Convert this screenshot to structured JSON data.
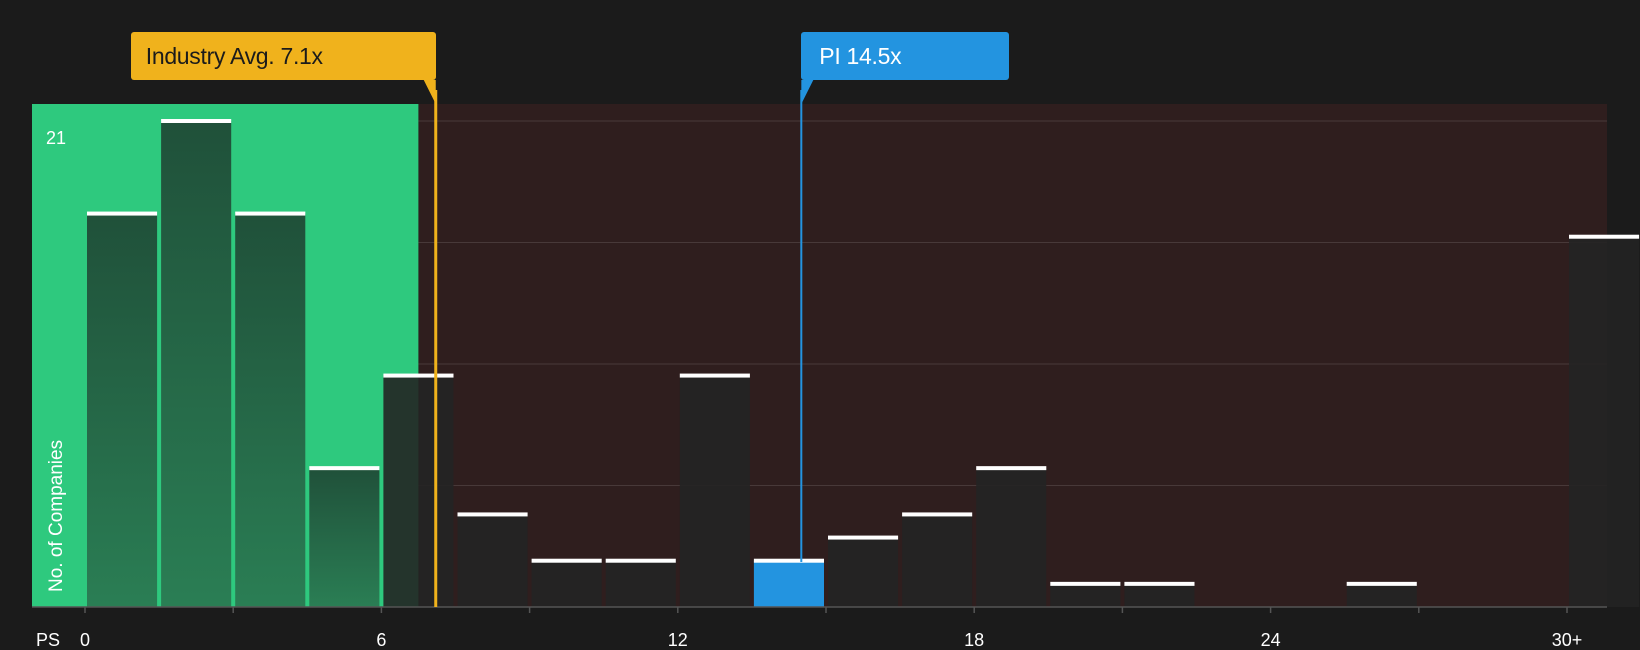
{
  "chart_data": {
    "type": "bar",
    "xlabel": "PS",
    "ylabel": "No. of Companies",
    "x_ticks": [
      "0",
      "6",
      "12",
      "18",
      "24",
      "30+"
    ],
    "y_max_label": "21",
    "ylim": [
      0,
      21
    ],
    "bins": [
      {
        "start": 0,
        "end": 1.5,
        "value": 17
      },
      {
        "start": 1.5,
        "end": 3,
        "value": 21
      },
      {
        "start": 3,
        "end": 4.5,
        "value": 17
      },
      {
        "start": 4.5,
        "end": 6,
        "value": 6
      },
      {
        "start": 6,
        "end": 7.5,
        "value": 10
      },
      {
        "start": 7.5,
        "end": 9,
        "value": 4
      },
      {
        "start": 9,
        "end": 10.5,
        "value": 2
      },
      {
        "start": 10.5,
        "end": 12,
        "value": 2
      },
      {
        "start": 12,
        "end": 13.5,
        "value": 10
      },
      {
        "start": 13.5,
        "end": 15,
        "value": 2
      },
      {
        "start": 15,
        "end": 16.5,
        "value": 3
      },
      {
        "start": 16.5,
        "end": 18,
        "value": 4
      },
      {
        "start": 18,
        "end": 19.5,
        "value": 6
      },
      {
        "start": 19.5,
        "end": 21,
        "value": 1
      },
      {
        "start": 21,
        "end": 22.5,
        "value": 1
      },
      {
        "start": 22.5,
        "end": 24,
        "value": 0
      },
      {
        "start": 24,
        "end": 25.5,
        "value": 0
      },
      {
        "start": 25.5,
        "end": 27,
        "value": 1
      },
      {
        "start": 27,
        "end": 28.5,
        "value": 0
      },
      {
        "start": 28.5,
        "end": 30,
        "value": 0
      },
      {
        "start": 30,
        "end": 31.5,
        "value": 16
      }
    ],
    "industry_avg": {
      "label": "Industry Avg. 7.1x",
      "value": 7.1
    },
    "company": {
      "label": "PI 14.5x",
      "value": 14.5
    },
    "colors": {
      "background": "#1b1b1b",
      "undervalued_zone": "#2ec97e",
      "overvalued_zone": "#2f1e1e",
      "bar_dark": "#232323",
      "bar_highlight": "#2394e0",
      "industry": "#f0b21c",
      "company": "#2394e0",
      "cap": "#ffffff"
    }
  }
}
